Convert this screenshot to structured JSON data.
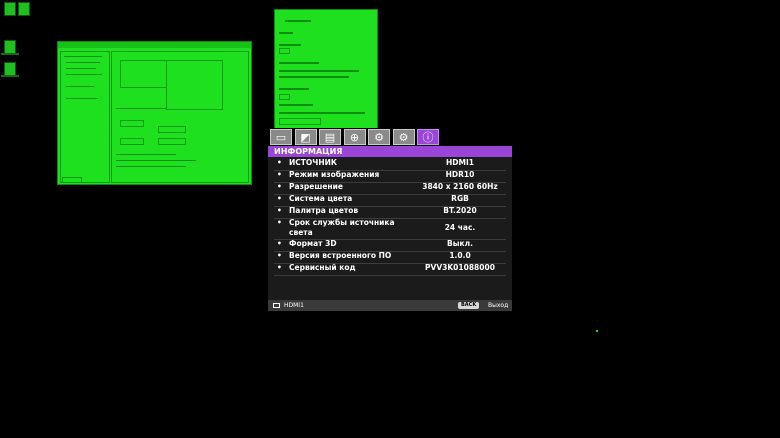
{
  "osd": {
    "tabs": [
      {
        "name": "picture-tab",
        "glyph": "▭"
      },
      {
        "name": "display-tab",
        "glyph": "◩"
      },
      {
        "name": "setup-tab",
        "glyph": "▤"
      },
      {
        "name": "network-tab",
        "glyph": "⊕"
      },
      {
        "name": "system-tab",
        "glyph": "⚙"
      },
      {
        "name": "advanced-tab",
        "glyph": "⚙"
      },
      {
        "name": "info-tab",
        "glyph": "ⓘ"
      }
    ],
    "header": "ИНФОРМАЦИЯ",
    "rows": [
      {
        "label": "ИСТОЧНИК",
        "value": "HDMI1"
      },
      {
        "label": "Режим изображения",
        "value": "HDR10"
      },
      {
        "label": "Разрешение",
        "value": "3840 x 2160 60Hz"
      },
      {
        "label": "Система цвета",
        "value": "RGB"
      },
      {
        "label": "Палитра цветов",
        "value": "BT.2020"
      },
      {
        "label": "Срок службы источника света",
        "value": "24 час."
      },
      {
        "label": "Формат 3D",
        "value": "Выкл."
      },
      {
        "label": "Версия встроенного ПО",
        "value": "1.0.0"
      },
      {
        "label": "Сервисный код",
        "value": "PVV3K01088000"
      }
    ],
    "footer": {
      "source": "HDMI1",
      "back_button": "BACK",
      "exit_label": "Выход"
    }
  },
  "colors": {
    "accent": "#9b45d8",
    "overlay_green": "#1fe01f",
    "panel": "#1b1b1b"
  }
}
